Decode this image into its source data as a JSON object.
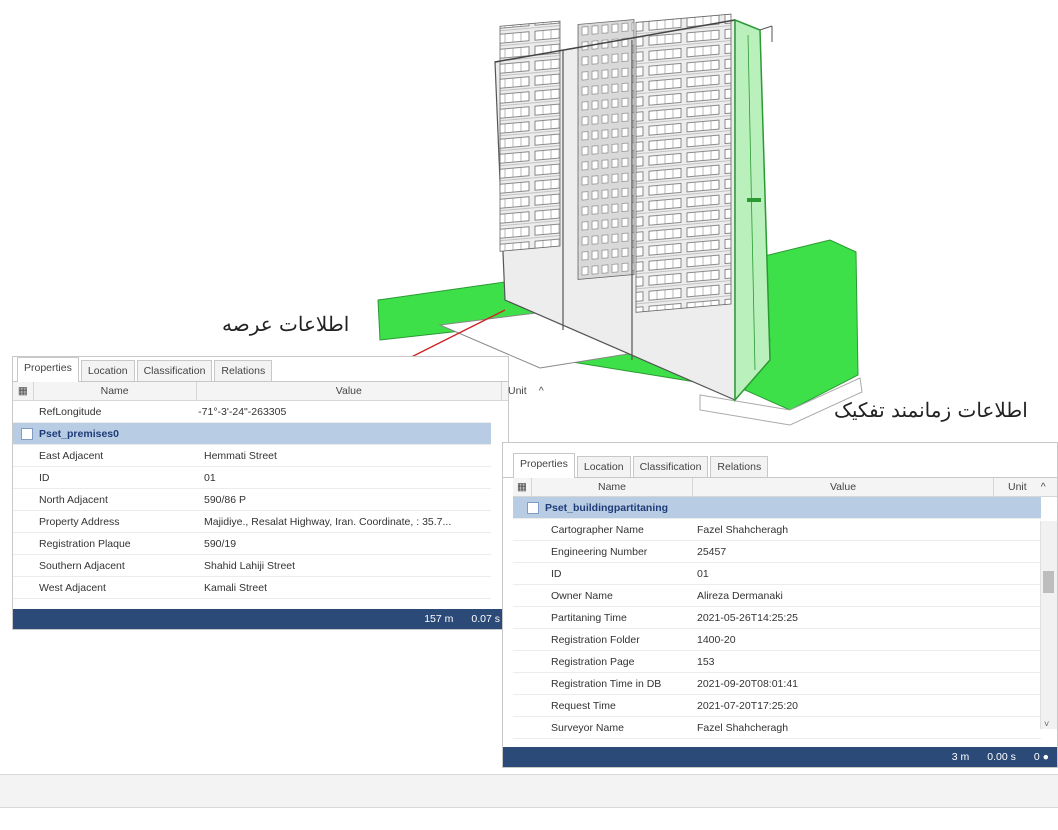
{
  "annotations": {
    "parcel_info": "اطلاعات عرصه",
    "temporal_partition_info": "اطلاعات زمانمند تفکیک"
  },
  "colors": {
    "ground_green": "#3ee04a",
    "header_blue": "#2b4a78",
    "group_row": "#b8cce4",
    "arrow": "#cc2222"
  },
  "panel1": {
    "tabs": [
      "Properties",
      "Location",
      "Classification",
      "Relations"
    ],
    "headers": {
      "name": "Name",
      "value": "Value",
      "unit": "Unit"
    },
    "top_row": {
      "name": "RefLongitude",
      "value": "-71°-3'-24\"-263305"
    },
    "group": "Pset_premises0",
    "rows": [
      {
        "name": "East Adjacent",
        "value": "Hemmati Street"
      },
      {
        "name": "ID",
        "value": "01"
      },
      {
        "name": "North Adjacent",
        "value": "590/86 P"
      },
      {
        "name": "Property Address",
        "value": "Majidiye., Resalat Highway, Iran. Coordinate, : 35.7..."
      },
      {
        "name": "Registration Plaque",
        "value": "590/19"
      },
      {
        "name": "Southern Adjacent",
        "value": "Shahid Lahiji Street"
      },
      {
        "name": "West Adjacent",
        "value": "Kamali Street"
      }
    ],
    "status": {
      "distance": "157 m",
      "time": "0.07 s"
    }
  },
  "panel2": {
    "tabs": [
      "Properties",
      "Location",
      "Classification",
      "Relations"
    ],
    "headers": {
      "name": "Name",
      "value": "Value",
      "unit": "Unit"
    },
    "group": "Pset_buildingpartitaning",
    "rows": [
      {
        "name": "Cartographer Name",
        "value": "Fazel Shahcheragh"
      },
      {
        "name": "Engineering Number",
        "value": "25457"
      },
      {
        "name": "ID",
        "value": "01"
      },
      {
        "name": "Owner Name",
        "value": "Alireza Dermanaki"
      },
      {
        "name": "Partitaning Time",
        "value": "2021-05-26T14:25:25"
      },
      {
        "name": "Registration Folder",
        "value": "1400-20"
      },
      {
        "name": "Registration Page",
        "value": "153"
      },
      {
        "name": "Registration Time in DB",
        "value": "2021-09-20T08:01:41"
      },
      {
        "name": "Request Time",
        "value": "2021-07-20T17:25:20"
      },
      {
        "name": "Surveyor Name",
        "value": "Fazel Shahcheragh"
      }
    ],
    "status": {
      "distance": "3 m",
      "time": "0.00 s",
      "count": "0 ●"
    }
  }
}
